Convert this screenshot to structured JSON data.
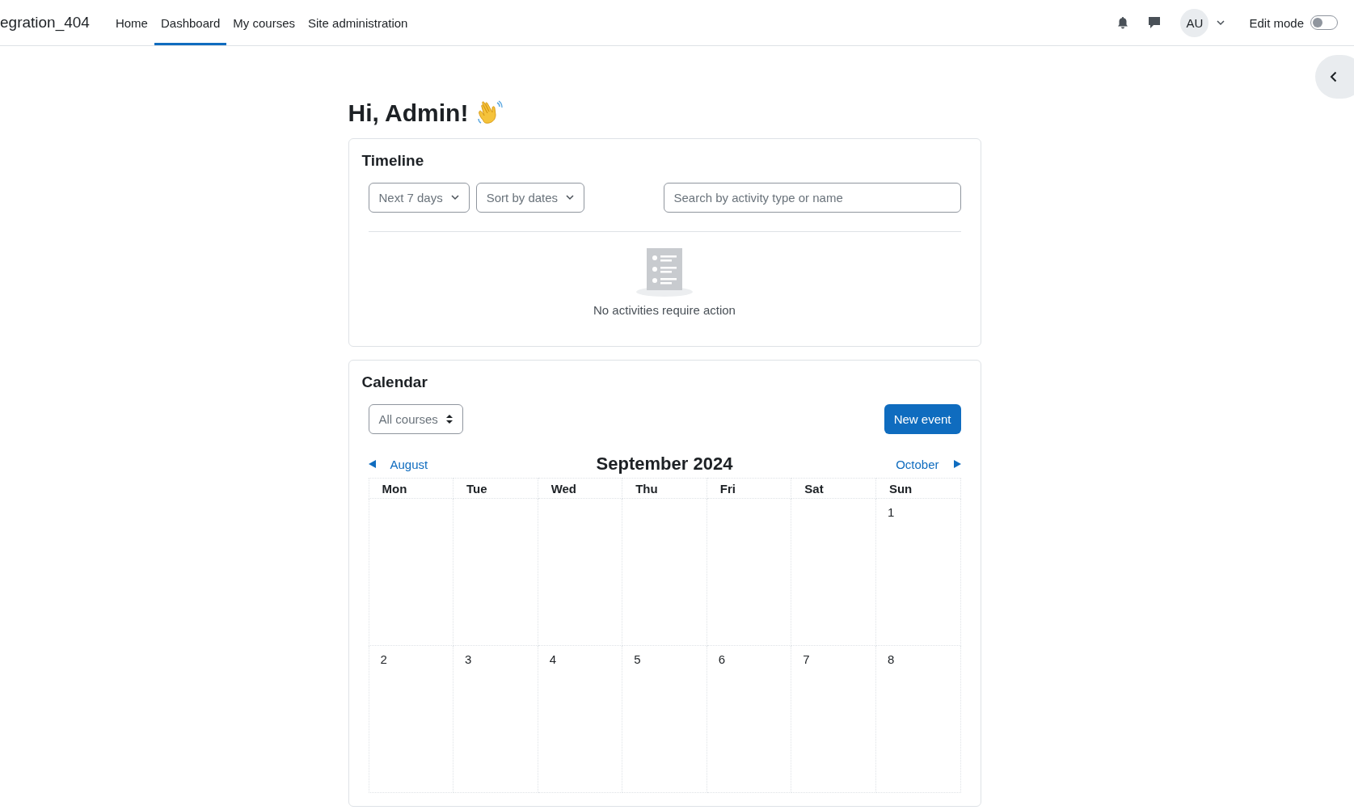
{
  "navbar": {
    "site_name": "egration_404",
    "items": [
      {
        "label": "Home",
        "selected": false
      },
      {
        "label": "Dashboard",
        "selected": true
      },
      {
        "label": "My courses",
        "selected": false
      },
      {
        "label": "Site administration",
        "selected": false
      }
    ],
    "avatar": "AU",
    "edit_mode": {
      "label": "Edit mode",
      "on": false
    }
  },
  "greeting": "Hi, Admin!",
  "timeline": {
    "title": "Timeline",
    "filters": [
      "Next 7 days",
      "Sort by dates"
    ],
    "search": {
      "placeholder": "Search by activity type or name"
    },
    "empty_message": "No activities require action"
  },
  "calendar": {
    "title": "Calendar",
    "course_filter": "All courses",
    "new_event": "New event",
    "prev_month": "August",
    "month": "September 2024",
    "next_month": "October",
    "weekdays": [
      "Mon",
      "Tue",
      "Wed",
      "Thu",
      "Fri",
      "Sat",
      "Sun"
    ],
    "weeks": [
      {
        "days": [
          {
            "kind": "blank"
          },
          {
            "kind": "blank"
          },
          {
            "kind": "blank"
          },
          {
            "kind": "blank"
          },
          {
            "kind": "blank"
          },
          {
            "kind": "blank"
          },
          {
            "kind": "day",
            "number": "1"
          }
        ]
      },
      {
        "days": [
          {
            "kind": "day",
            "number": "2"
          },
          {
            "kind": "day",
            "number": "3"
          },
          {
            "kind": "day",
            "number": "4"
          },
          {
            "kind": "day",
            "number": "5"
          },
          {
            "kind": "day",
            "number": "6"
          },
          {
            "kind": "day",
            "number": "7"
          },
          {
            "kind": "day",
            "number": "8"
          }
        ]
      }
    ]
  }
}
